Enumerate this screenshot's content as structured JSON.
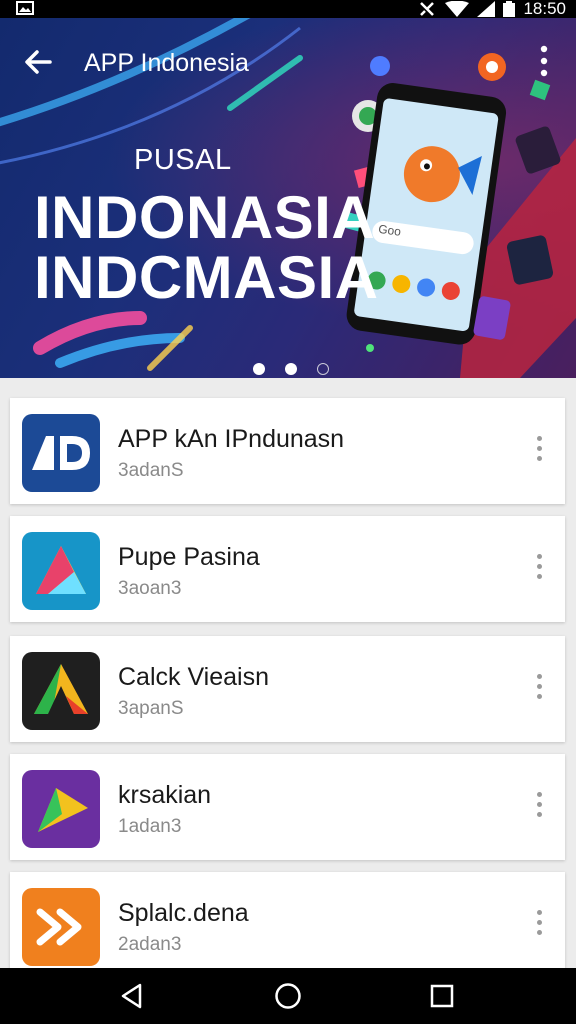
{
  "status_bar": {
    "time": "18:50",
    "icons": [
      "image-icon",
      "no-signal-icon",
      "wifi-icon",
      "signal-icon",
      "battery-icon"
    ]
  },
  "toolbar": {
    "title": "APP Indonesia",
    "back_icon": "arrow-back-icon",
    "more_icon": "more-vert-icon"
  },
  "hero": {
    "subtitle": "PUSAL",
    "line1": "INDONASIA",
    "line2": "INDCMASIA",
    "search_text": "Goo",
    "pager": {
      "count": 3,
      "active_index": 0
    }
  },
  "apps": [
    {
      "name": "APP kAn IPndunasn",
      "subtitle": "3adanS",
      "icon": "app-1d-icon",
      "icon_color": "#1c4a96"
    },
    {
      "name": "Pupe Pasina",
      "subtitle": "3aoan3",
      "icon": "app-triangle-icon",
      "icon_color": "#1795c8"
    },
    {
      "name": "Calck Vieaisn",
      "subtitle": "3apanS",
      "icon": "app-arrow-icon",
      "icon_color": "#1f1f1f"
    },
    {
      "name": "krsakian",
      "subtitle": "1adan3",
      "icon": "app-play-arrow-icon",
      "icon_color": "#6a2fa0"
    },
    {
      "name": "Splalc.dena",
      "subtitle": "2adan3",
      "icon": "app-forward-icon",
      "icon_color": "#f0801e"
    }
  ],
  "nav_bar": {
    "items": [
      "back-triangle-icon",
      "home-circle-icon",
      "recents-square-icon"
    ]
  }
}
